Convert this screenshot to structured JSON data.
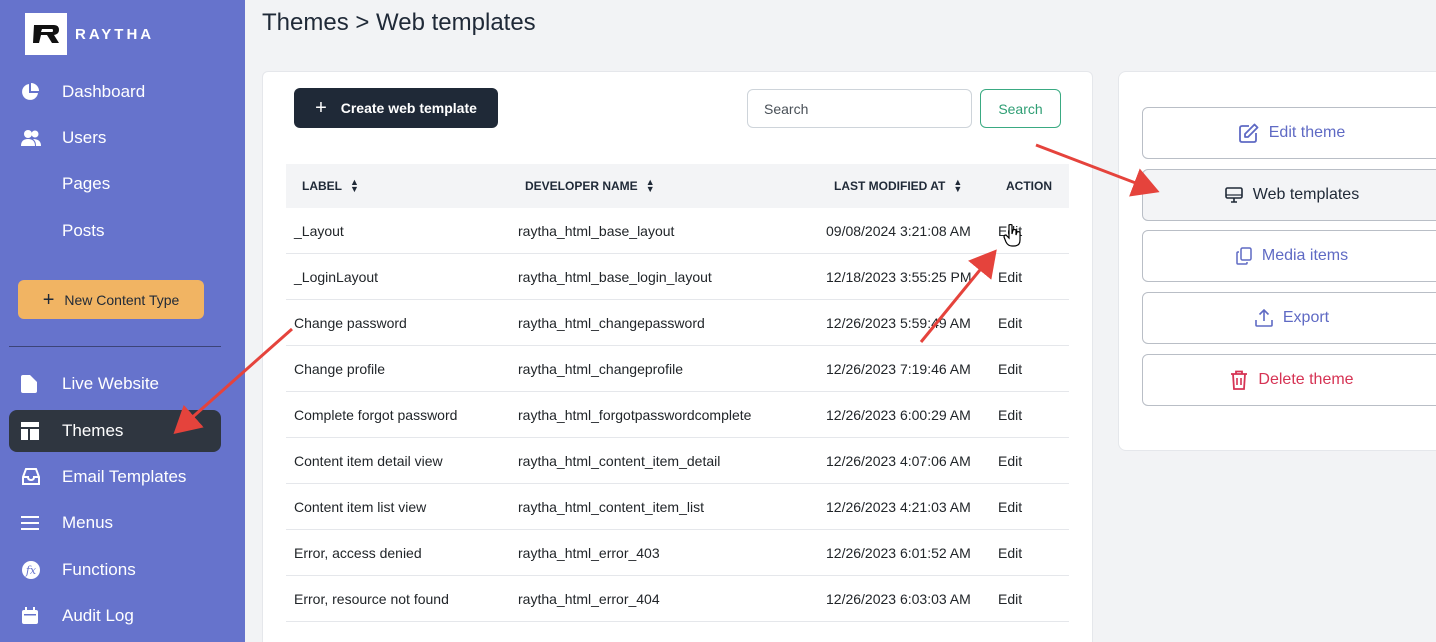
{
  "brand": {
    "name": "RAYTHA"
  },
  "sidebar": {
    "items": [
      {
        "label": "Dashboard",
        "icon": "pie-chart-icon"
      },
      {
        "label": "Users",
        "icon": "users-icon"
      },
      {
        "label": "Pages"
      },
      {
        "label": "Posts"
      },
      {
        "label": "Live Website",
        "icon": "file-icon"
      },
      {
        "label": "Themes",
        "icon": "layout-icon",
        "active": true
      },
      {
        "label": "Email Templates",
        "icon": "inbox-icon"
      },
      {
        "label": "Menus",
        "icon": "menu-icon"
      },
      {
        "label": "Functions",
        "icon": "function-icon"
      },
      {
        "label": "Audit Log",
        "icon": "calendar-icon"
      }
    ],
    "new_content_type": "New Content Type"
  },
  "page": {
    "title": "Themes > Web templates"
  },
  "toolbar": {
    "create_label": "Create web template",
    "search_placeholder": "Search",
    "search_button": "Search"
  },
  "table": {
    "headers": [
      "LABEL",
      "DEVELOPER NAME",
      "LAST MODIFIED AT",
      "ACTION"
    ],
    "rows": [
      {
        "label": "_Layout",
        "developer_name": "raytha_html_base_layout",
        "modified": "09/08/2024 3:21:08 AM",
        "action": "Edit"
      },
      {
        "label": "_LoginLayout",
        "developer_name": "raytha_html_base_login_layout",
        "modified": "12/18/2023 3:55:25 PM",
        "action": "Edit"
      },
      {
        "label": "Change password",
        "developer_name": "raytha_html_changepassword",
        "modified": "12/26/2023 5:59:49 AM",
        "action": "Edit"
      },
      {
        "label": "Change profile",
        "developer_name": "raytha_html_changeprofile",
        "modified": "12/26/2023 7:19:46 AM",
        "action": "Edit"
      },
      {
        "label": "Complete forgot password",
        "developer_name": "raytha_html_forgotpasswordcomplete",
        "modified": "12/26/2023 6:00:29 AM",
        "action": "Edit"
      },
      {
        "label": "Content item detail view",
        "developer_name": "raytha_html_content_item_detail",
        "modified": "12/26/2023 4:07:06 AM",
        "action": "Edit"
      },
      {
        "label": "Content item list view",
        "developer_name": "raytha_html_content_item_list",
        "modified": "12/26/2023 4:21:03 AM",
        "action": "Edit"
      },
      {
        "label": "Error, access denied",
        "developer_name": "raytha_html_error_403",
        "modified": "12/26/2023 6:01:52 AM",
        "action": "Edit"
      },
      {
        "label": "Error, resource not found",
        "developer_name": "raytha_html_error_404",
        "modified": "12/26/2023 6:03:03 AM",
        "action": "Edit"
      }
    ]
  },
  "theme_actions": {
    "edit_theme": "Edit theme",
    "web_templates": "Web templates",
    "media_items": "Media items",
    "export": "Export",
    "delete_theme": "Delete theme"
  },
  "colors": {
    "sidebar": "#6673cc",
    "active_nav": "#2f3640",
    "accent_button": "#f1b463",
    "primary_dark": "#1f2937",
    "success": "#2f9e74",
    "danger": "#d63354",
    "annotation_arrow": "#e5433c"
  }
}
